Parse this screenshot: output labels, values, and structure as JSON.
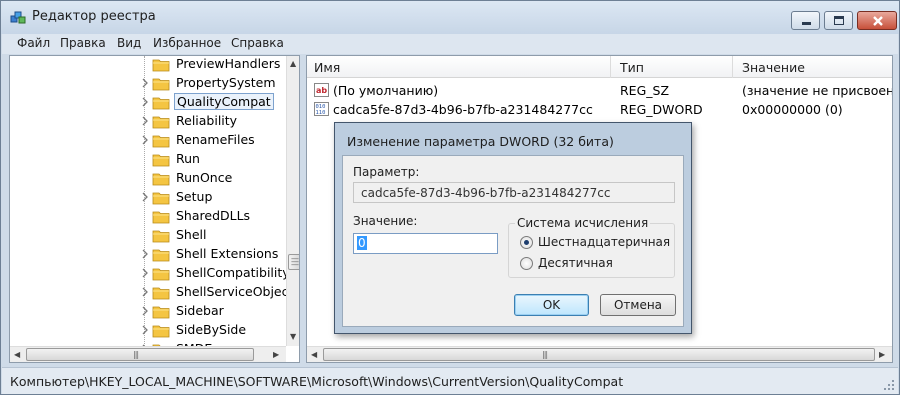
{
  "window": {
    "title": "Редактор реестра",
    "buttons": [
      "minimize",
      "maximize",
      "close"
    ]
  },
  "menu": [
    "Файл",
    "Правка",
    "Вид",
    "Избранное",
    "Справка"
  ],
  "tree": {
    "items": [
      {
        "label": "PreviewHandlers",
        "expandable": false
      },
      {
        "label": "PropertySystem",
        "expandable": true
      },
      {
        "label": "QualityCompat",
        "expandable": true,
        "selected": true
      },
      {
        "label": "Reliability",
        "expandable": true
      },
      {
        "label": "RenameFiles",
        "expandable": true
      },
      {
        "label": "Run",
        "expandable": false
      },
      {
        "label": "RunOnce",
        "expandable": false
      },
      {
        "label": "Setup",
        "expandable": true
      },
      {
        "label": "SharedDLLs",
        "expandable": false
      },
      {
        "label": "Shell",
        "expandable": false
      },
      {
        "label": "Shell Extensions",
        "expandable": true
      },
      {
        "label": "ShellCompatibility",
        "expandable": true
      },
      {
        "label": "ShellServiceObjectD",
        "expandable": true
      },
      {
        "label": "Sidebar",
        "expandable": true
      },
      {
        "label": "SideBySide",
        "expandable": true
      },
      {
        "label": "SMDEn",
        "expandable": true
      }
    ]
  },
  "list": {
    "columns": [
      "Имя",
      "Тип",
      "Значение"
    ],
    "rows": [
      {
        "icon": "string-value-icon",
        "name": "(По умолчанию)",
        "type": "REG_SZ",
        "value": "(значение не присвоено)"
      },
      {
        "icon": "binary-value-icon",
        "name": "cadca5fe-87d3-4b96-b7fb-a231484277cc",
        "type": "REG_DWORD",
        "value": "0x00000000 (0)"
      }
    ]
  },
  "status": {
    "path": "Компьютер\\HKEY_LOCAL_MACHINE\\SOFTWARE\\Microsoft\\Windows\\CurrentVersion\\QualityCompat"
  },
  "dialog": {
    "title": "Изменение параметра DWORD (32 бита)",
    "name_label": "Параметр:",
    "name_value": "cadca5fe-87d3-4b96-b7fb-a231484277cc",
    "value_label": "Значение:",
    "value": "0",
    "base_legend": "Система исчисления",
    "base_options": [
      {
        "label": "Шестнадцатеричная",
        "selected": true
      },
      {
        "label": "Десятичная",
        "selected": false
      }
    ],
    "ok_label": "OK",
    "cancel_label": "Отмена"
  },
  "colors": {
    "window_frame": "#cfdbe8",
    "dialog_frame": "#bccddf",
    "selection": "#3399ff",
    "folder": "#f4c542"
  }
}
